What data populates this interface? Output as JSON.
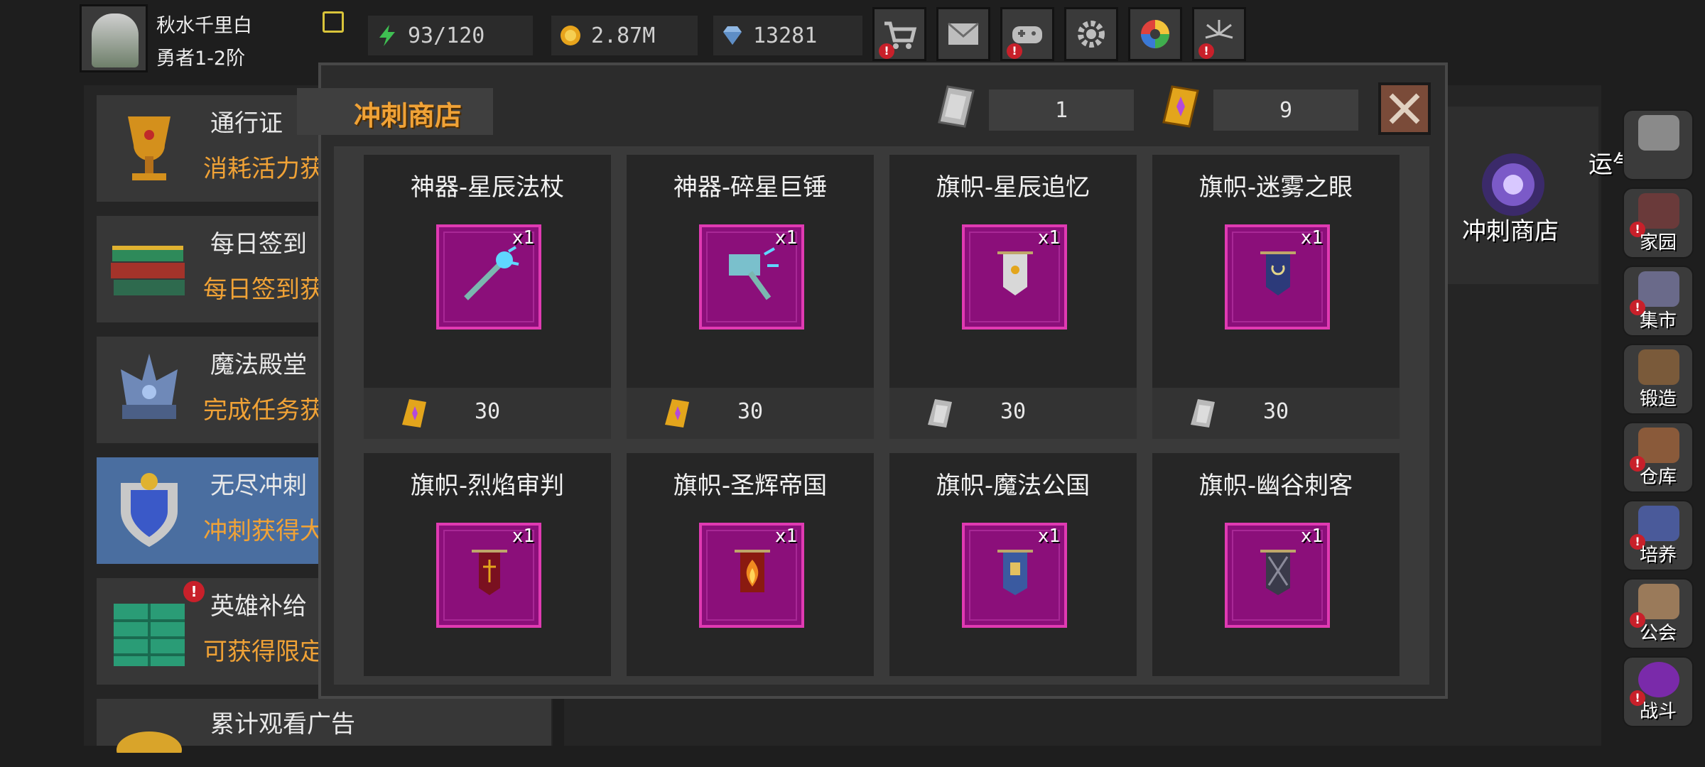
{
  "player": {
    "name": "秋水千里白",
    "rank": "勇者1-2阶"
  },
  "resources": [
    {
      "icon": "energy-icon",
      "value": "93/120"
    },
    {
      "icon": "gold-coin-icon",
      "value": "2.87M"
    },
    {
      "icon": "diamond-icon",
      "value": "13281"
    }
  ],
  "top_buttons": [
    {
      "icon": "shop-cart-icon",
      "alert": true
    },
    {
      "icon": "mail-icon",
      "alert": false
    },
    {
      "icon": "gamepad-icon",
      "alert": true
    },
    {
      "icon": "gear-icon",
      "alert": false
    },
    {
      "icon": "color-wheel-icon",
      "alert": false
    },
    {
      "icon": "fireworks-icon",
      "alert": true
    }
  ],
  "left_list": [
    {
      "title": "通行证",
      "desc": "消耗活力获"
    },
    {
      "title": "每日签到",
      "desc": "每日签到获"
    },
    {
      "title": "魔法殿堂",
      "desc": "完成任务获"
    },
    {
      "title": "无尽冲刺",
      "desc": "冲刺获得大"
    },
    {
      "title": "英雄补给",
      "desc": "可获得限定"
    },
    {
      "title": "累计观看广告",
      "desc": ""
    }
  ],
  "side_menu": [
    {
      "label": "家园",
      "alert": true
    },
    {
      "label": "集市",
      "alert": true
    },
    {
      "label": "锻造",
      "alert": false
    },
    {
      "label": "仓库",
      "alert": true
    },
    {
      "label": "培养",
      "alert": true
    },
    {
      "label": "公会",
      "alert": true
    },
    {
      "label": "战斗",
      "alert": true
    }
  ],
  "floating": {
    "luck_text": "运气爆棚!",
    "sprint_shop_label": "冲刺商店"
  },
  "shop": {
    "title": "冲刺商店",
    "currency": [
      {
        "icon": "silver-token-icon",
        "value": "1"
      },
      {
        "icon": "gold-token-icon",
        "value": "9"
      }
    ],
    "items": [
      {
        "name": "神器-星辰法杖",
        "qty": "x1",
        "price": "30",
        "price_icon": "gold-token-icon"
      },
      {
        "name": "神器-碎星巨锤",
        "qty": "x1",
        "price": "30",
        "price_icon": "gold-token-icon"
      },
      {
        "name": "旗帜-星辰追忆",
        "qty": "x1",
        "price": "30",
        "price_icon": "silver-token-icon"
      },
      {
        "name": "旗帜-迷雾之眼",
        "qty": "x1",
        "price": "30",
        "price_icon": "silver-token-icon"
      },
      {
        "name": "旗帜-烈焰审判",
        "qty": "x1",
        "price": "",
        "price_icon": ""
      },
      {
        "name": "旗帜-圣辉帝国",
        "qty": "x1",
        "price": "",
        "price_icon": ""
      },
      {
        "name": "旗帜-魔法公国",
        "qty": "x1",
        "price": "",
        "price_icon": ""
      },
      {
        "name": "旗帜-幽谷刺客",
        "qty": "x1",
        "price": "",
        "price_icon": ""
      }
    ]
  },
  "colors": {
    "accent_orange": "#f0a236",
    "item_frame": "#8b0f7a",
    "item_border": "#e03ab2",
    "close_bg": "#7a4b39",
    "selected_row": "#4a6ea0"
  }
}
